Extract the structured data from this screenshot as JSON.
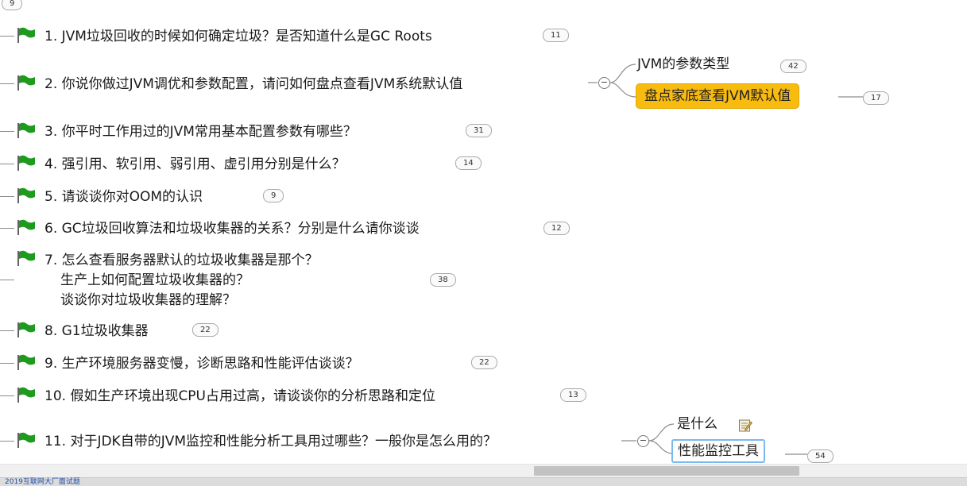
{
  "top_badge": "9",
  "topics": [
    {
      "lines": [
        "1. JVM垃圾回收的时候如何确定垃圾？是否知道什么是GC Roots"
      ],
      "count": "11"
    },
    {
      "lines": [
        "2. 你说你做过JVM调优和参数配置，请问如何盘点查看JVM系统默认值"
      ],
      "count": ""
    },
    {
      "lines": [
        "3. 你平时工作用过的JVM常用基本配置参数有哪些？"
      ],
      "count": "31"
    },
    {
      "lines": [
        "4. 强引用、软引用、弱引用、虚引用分别是什么？"
      ],
      "count": "14"
    },
    {
      "lines": [
        "5. 请谈谈你对OOM的认识"
      ],
      "count": "9"
    },
    {
      "lines": [
        "6. GC垃圾回收算法和垃圾收集器的关系？分别是什么请你谈谈"
      ],
      "count": "12"
    },
    {
      "lines": [
        "7. 怎么查看服务器默认的垃圾收集器是那个？",
        "生产上如何配置垃圾收集器的？",
        "谈谈你对垃圾收集器的理解？"
      ],
      "count": "38"
    },
    {
      "lines": [
        "8. G1垃圾收集器"
      ],
      "count": "22"
    },
    {
      "lines": [
        "9. 生产环境服务器变慢，诊断思路和性能评估谈谈？"
      ],
      "count": "22"
    },
    {
      "lines": [
        "10. 假如生产环境出现CPU占用过高，请谈谈你的分析思路和定位"
      ],
      "count": "13"
    },
    {
      "lines": [
        "11. 对于JDK自带的JVM监控和性能分析工具用过哪些？一般你是怎么用的？"
      ],
      "count": ""
    }
  ],
  "branch2": {
    "collapse": "−",
    "sub1": {
      "label": "JVM的参数类型",
      "count": "42"
    },
    "sub2": {
      "label": "盘点家底查看JVM默认值",
      "count": "17"
    }
  },
  "branch11": {
    "collapse": "−",
    "sub1": {
      "label": "是什么"
    },
    "sub2": {
      "label": "性能监控工具",
      "count": "54"
    }
  },
  "status": {
    "doc_name": "2019互联网大厂面试题"
  },
  "colors": {
    "flag": "#1e9a1e",
    "selected_topic": "#f8bb0f",
    "edit_border": "#7ab8ef"
  }
}
